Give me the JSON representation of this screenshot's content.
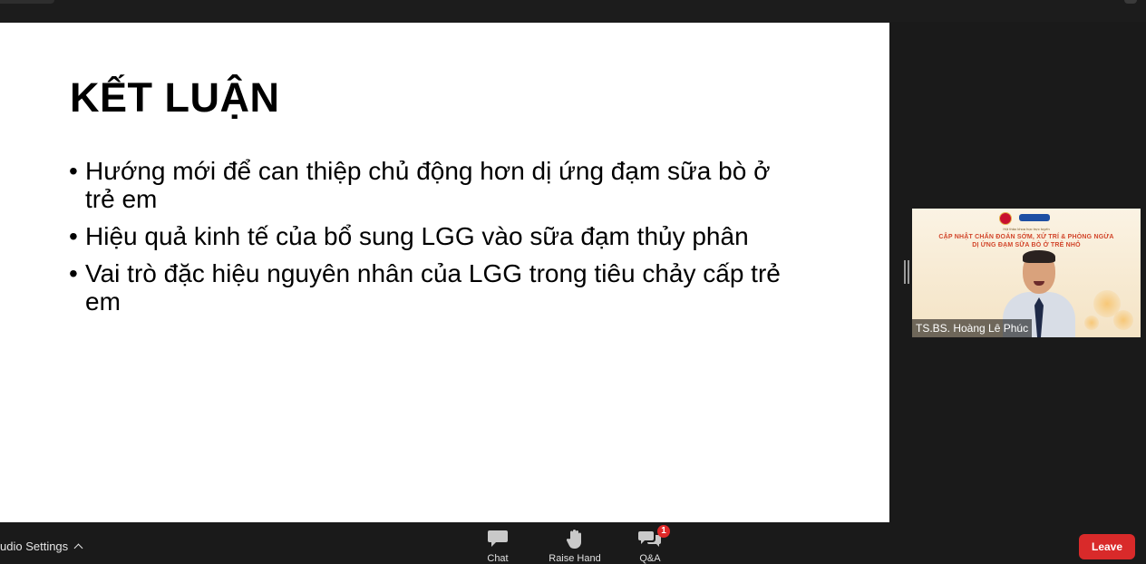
{
  "slide": {
    "title": "KẾT LUẬN",
    "bullets": [
      "Hướng mới để can thiệp chủ động hơn dị ứng đạm sữa bò ở trẻ em",
      "Hiệu quả kinh tế của bổ sung LGG vào sữa đạm thủy phân",
      "Vai trò đặc hiệu nguyên nhân của LGG trong tiêu chảy cấp trẻ em"
    ]
  },
  "speaker": {
    "name": "TS.BS. Hoàng Lê Phúc",
    "banner_line1": "CẬP NHẬT CHẨN ĐOÁN SỚM, XỬ TRÍ & PHÒNG NGỪA",
    "banner_line2": "DỊ ỨNG ĐẠM SỮA BÒ Ở TRẺ NHỎ",
    "banner_small": "Hội thảo khoa học trực tuyến"
  },
  "toolbar": {
    "audio_settings_label": "udio Settings",
    "chat_label": "Chat",
    "raise_hand_label": "Raise Hand",
    "qa_label": "Q&A",
    "qa_badge": "1",
    "leave_label": "Leave"
  },
  "icons": {
    "chat": "chat-bubble-icon",
    "raise_hand": "hand-icon",
    "qa": "qa-bubbles-icon",
    "chevron": "chevron-up-icon"
  },
  "colors": {
    "background": "#1a1a1a",
    "leave": "#d92a2a",
    "badge": "#e02828"
  }
}
